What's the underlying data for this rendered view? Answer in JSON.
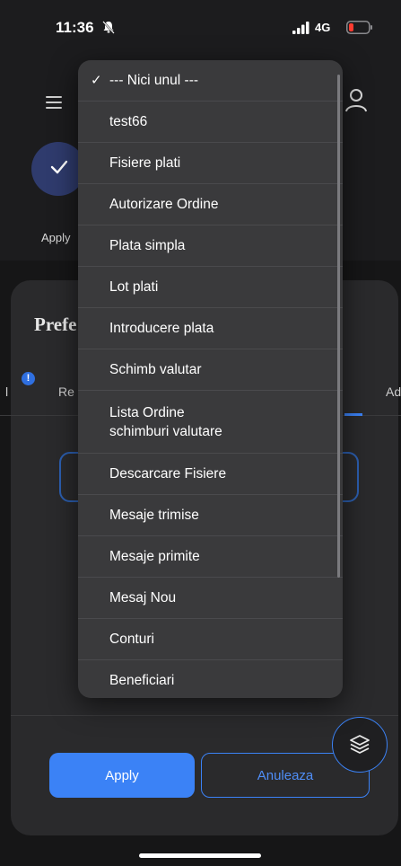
{
  "status_bar": {
    "time": "11:36",
    "network": "4G",
    "mute_icon": "bell-slash-icon",
    "battery_color": "#ff3b30"
  },
  "stepper": {
    "step_label": "Apply"
  },
  "panel": {
    "title": "Prefe",
    "tabs": {
      "left": "l",
      "middle": "Re",
      "right": "Ad"
    },
    "badge": "!"
  },
  "dropdown": {
    "items": [
      {
        "label": "--- Nici unul ---",
        "selected": true
      },
      {
        "label": "test66"
      },
      {
        "label": "Fisiere plati"
      },
      {
        "label": "Autorizare Ordine"
      },
      {
        "label": "Plata simpla"
      },
      {
        "label": "Lot plati"
      },
      {
        "label": "Introducere plata"
      },
      {
        "label": "Schimb valutar"
      },
      {
        "label": "Lista Ordine\nschimburi valutare"
      },
      {
        "label": "Descarcare Fisiere"
      },
      {
        "label": "Mesaje trimise"
      },
      {
        "label": "Mesaje primite"
      },
      {
        "label": "Mesaj Nou"
      },
      {
        "label": "Conturi"
      },
      {
        "label": "Beneficiari"
      }
    ],
    "check_mark": "✓"
  },
  "actions": {
    "apply_label": "Apply",
    "cancel_label": "Anuleaza"
  },
  "colors": {
    "accent": "#3b82f6",
    "background": "#1c1c1e"
  }
}
